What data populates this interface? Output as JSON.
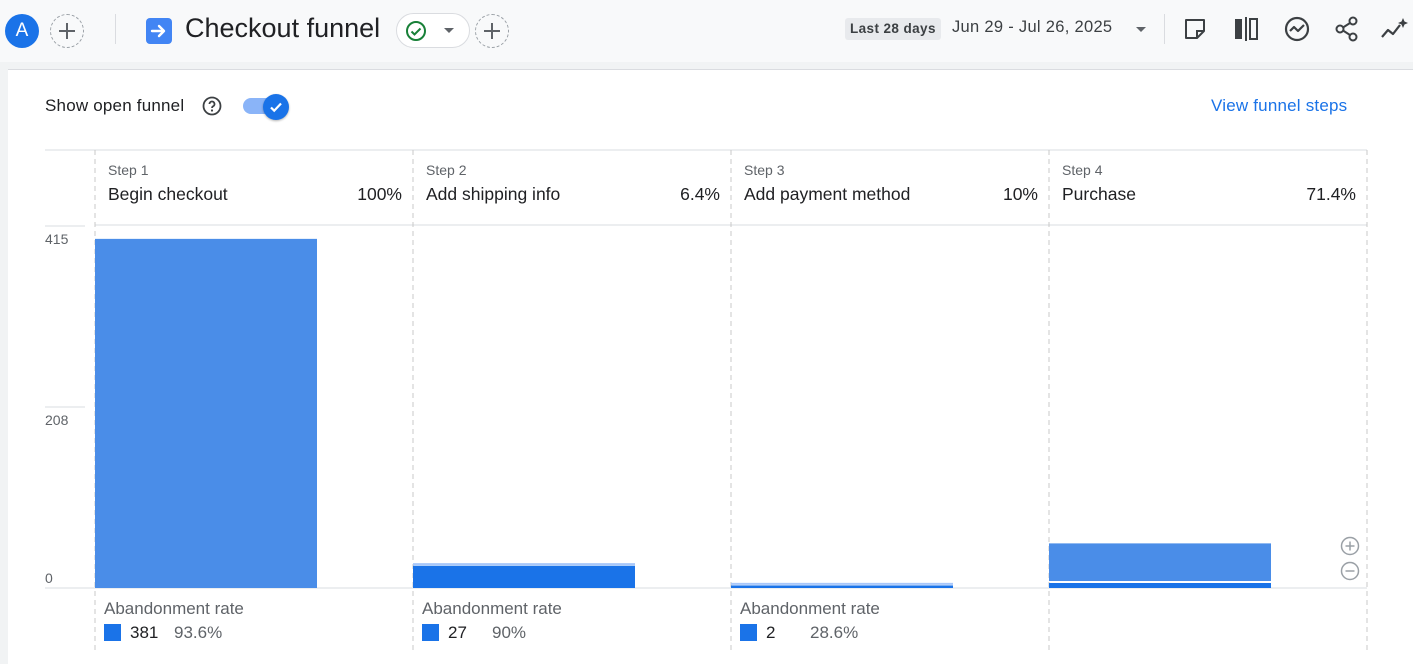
{
  "header": {
    "avatar_letter": "A",
    "report_title": "Checkout funnel",
    "date_chip": "Last 28 days",
    "date_range": "Jun 29 - Jul 26, 2025",
    "icons": [
      "add-comparison-icon",
      "report-arrow-icon",
      "verified-check-icon",
      "dropdown-caret-icon",
      "add-icon",
      "notes-icon",
      "compare-columns-icon",
      "insights-icon",
      "share-icon",
      "sparkle-icon"
    ]
  },
  "controls": {
    "show_open_funnel": "Show open funnel",
    "toggle_on": true,
    "view_funnel_steps": "View funnel steps"
  },
  "chart_data": {
    "type": "bar",
    "categories": [
      "Begin checkout",
      "Add shipping info",
      "Add payment method",
      "Purchase"
    ],
    "ylim": [
      0,
      415
    ],
    "yticks": [
      "415",
      "208",
      "0"
    ],
    "steps": [
      {
        "step": "Step 1",
        "name": "Begin checkout",
        "pct": "100%",
        "active_users": 407,
        "abandon_label": "Abandonment rate",
        "abandon_count": "381",
        "abandon_rate": "93.6%"
      },
      {
        "step": "Step 2",
        "name": "Add shipping info",
        "pct": "6.4%",
        "active_users": 26,
        "abandon_label": "Abandonment rate",
        "abandon_count": "27",
        "abandon_rate": "90%"
      },
      {
        "step": "Step 3",
        "name": "Add payment method",
        "pct": "10%",
        "active_users": 3,
        "abandon_label": "Abandonment rate",
        "abandon_count": "2",
        "abandon_rate": "28.6%"
      },
      {
        "step": "Step 4",
        "name": "Purchase",
        "pct": "71.4%",
        "active_users": 52,
        "abandon_label": "",
        "abandon_count": "",
        "abandon_rate": ""
      }
    ],
    "outline_values": [
      null,
      29,
      6,
      7
    ],
    "colors": {
      "bar": "#4a8de8",
      "bar_dark": "#1a73e8",
      "outline": "#a8c7fa"
    }
  }
}
